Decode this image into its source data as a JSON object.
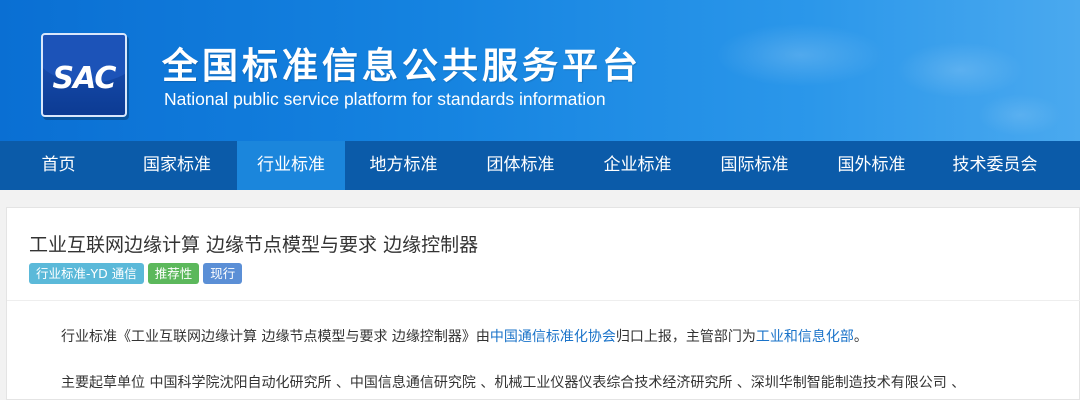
{
  "header": {
    "logo_text": "SAC",
    "title": "全国标准信息公共服务平台",
    "subtitle": "National public service platform  for standards information"
  },
  "nav": {
    "items": [
      {
        "label": "首页"
      },
      {
        "label": "国家标准"
      },
      {
        "label": "行业标准",
        "active": true
      },
      {
        "label": "地方标准"
      },
      {
        "label": "团体标准"
      },
      {
        "label": "企业标准"
      },
      {
        "label": "国际标准"
      },
      {
        "label": "国外标准"
      },
      {
        "label": "技术委员会"
      }
    ]
  },
  "standard": {
    "title": "工业互联网边缘计算 边缘节点模型与要求 边缘控制器",
    "tags": [
      {
        "label": "行业标准-YD 通信",
        "color": "#5bb9d9"
      },
      {
        "label": "推荐性",
        "color": "#5cb85c"
      },
      {
        "label": "现行",
        "color": "#5b8fd6"
      }
    ],
    "para1": {
      "prefix": "行业标准《工业互联网边缘计算 边缘节点模型与要求 边缘控制器》由",
      "org_link": "中国通信标准化协会",
      "middle": "归口上报，主管部门为",
      "dept_link": "工业和信息化部",
      "suffix": "。"
    },
    "para2": "主要起草单位 中国科学院沈阳自动化研究所 、中国信息通信研究院 、机械工业仪器仪表综合技术经济研究所 、深圳华制智能制造技术有限公司 、"
  },
  "colors": {
    "nav_bg": "#0b5ba9",
    "nav_active": "#1b86dc",
    "link": "#1a73c9"
  }
}
